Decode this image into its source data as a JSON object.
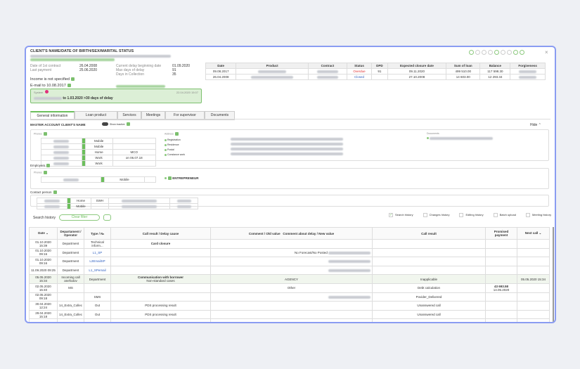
{
  "header": {
    "title": "CLIENT'S NAME/DATE OF BIRTH/SEX/MARITAL STATUS"
  },
  "info": {
    "first_contract_label": "Date of 1st contract",
    "first_contract": "26.04.2008",
    "last_payment_label": "Last payment",
    "last_payment": "25.06.2020",
    "delay_begin_label": "Current delay beginning date",
    "delay_begin": "01.09.2020",
    "max_delay_label": "Max days of delay",
    "max_delay": "91",
    "days_collection_label": "Days in Collection",
    "days_collection": "35",
    "income": "Income is not specified",
    "email": "E-mail to 10.08.2017"
  },
  "notice": {
    "source": "System",
    "text": "to 1.03.2020 >30 days of delay",
    "time": "22.04.2020 15:07"
  },
  "loans": {
    "headers": [
      "Date",
      "Product",
      "Contract",
      "Status",
      "DPD",
      "Expected closure date",
      "Sum of loan",
      "Balance",
      "Forgiveness"
    ],
    "rows": [
      {
        "date": "09.08.2017",
        "status": "Overdue",
        "dpd": "91",
        "closure": "09.11.2020",
        "sum": "499 510.00",
        "balance": "117 598.30"
      },
      {
        "date": "26.04.2008",
        "status": "Closed",
        "dpd": "",
        "closure": "27.10.2008",
        "sum": "14 603.00",
        "balance": "12 293.34"
      }
    ]
  },
  "tabs": [
    "General information",
    "Loan product",
    "Services",
    "Meetings",
    "For supervisor",
    "Documents"
  ],
  "general": {
    "master": "MASTER ACCOUNT CLIENT'S NAME",
    "show_inactive": "Show inactive",
    "hide": "Hide",
    "phones_label": "Phones",
    "phone_types": [
      "Mobile",
      "Mobile",
      "Home",
      "Work",
      "Work"
    ],
    "phone_note": "MCO",
    "phone_note2": "on 06.07.18",
    "address_label": "Address",
    "address_types": [
      "Registration",
      "Residence",
      "Postal",
      "Constance work"
    ],
    "documents_label": "Documents",
    "employers": "Employers",
    "emp_phone_type": "Mobile",
    "entrepreneur": "ENTREPRENEUR",
    "contact_person": "Contact person",
    "contact_types": [
      "Home",
      "Mobile"
    ],
    "contact_rel": "SWH"
  },
  "history": {
    "title": "Search history",
    "clear": "Clear filter",
    "filters": [
      "Search history",
      "Changes history",
      "Editing history",
      "Batch upload",
      "Meeting history"
    ],
    "headers": [
      "Date",
      "Departament / Operator",
      "Type / №",
      "Call result / Delay cause",
      "Comment / Old value",
      "Comment about delay / New value",
      "Call result",
      "Promised payment",
      "Next call"
    ],
    "rows": [
      {
        "date": "01.10.2020 15:39",
        "dept": "Department",
        "type": "Technical inform...",
        "res": "Card closure",
        "comment": "",
        "cres": "",
        "pay": "",
        "payd": "",
        "next": ""
      },
      {
        "date": "01.10.2020 09:16",
        "dept": "Department",
        "type": "L1_SP",
        "res": "",
        "comment": "No Forecast/No Posted",
        "cres": "",
        "pay": "",
        "payd": "",
        "next": ""
      },
      {
        "date": "01.10.2020 09:16",
        "dept": "Department",
        "type": "L2EmailSP",
        "res": "",
        "comment": "",
        "cres": "",
        "pay": "",
        "payd": "",
        "next": ""
      },
      {
        "date": "11.09.2020 09:25",
        "dept": "Department",
        "type": "L1_SPemail",
        "res": "",
        "comment": "",
        "cres": "",
        "pay": "",
        "payd": "",
        "next": ""
      },
      {
        "date": "05.05.2020 15:34",
        "dept": "Incoming call anefodov",
        "type": "Department",
        "res": "Communication with borrower",
        "res2": "Non-standard cases",
        "comment": "AGENCY",
        "cres": "Inapplicable",
        "pay": "",
        "payd": "",
        "next": "05.05.2020 15:34"
      },
      {
        "date": "02.05.2020 15:40",
        "dept": "MS",
        "type": "",
        "res": "",
        "comment": "Other",
        "cres": "Debt calculation",
        "pay": "43 693.58",
        "payd": "14.05.2020",
        "next": ""
      },
      {
        "date": "02.05.2020 09:18",
        "dept": "",
        "type": "SMS",
        "res": "",
        "comment": "",
        "cres": "Povider_Delivered",
        "pay": "",
        "payd": "",
        "next": ""
      },
      {
        "date": "30.04.2020 12:24",
        "dept": "14_Extra_Collec",
        "type": "Out",
        "res": "PDS processing result",
        "comment": "",
        "cres": "Unanswered call",
        "pay": "",
        "payd": "",
        "next": ""
      },
      {
        "date": "29.04.2020 15:18",
        "dept": "14_Extra_Collec",
        "type": "Out",
        "res": "PDS processing result",
        "comment": "",
        "cres": "Unanswered call",
        "pay": "",
        "payd": "",
        "next": ""
      },
      {
        "date": "",
        "dept": "",
        "type": "",
        "res": "",
        "comment": "",
        "cres": "Unanswered call",
        "pay": "",
        "payd": "",
        "next": ""
      }
    ]
  },
  "colors": {
    "accent": "#6cbf5c",
    "border": "#8a9cf2",
    "overdue": "#e03030",
    "closed": "#3060c0"
  }
}
